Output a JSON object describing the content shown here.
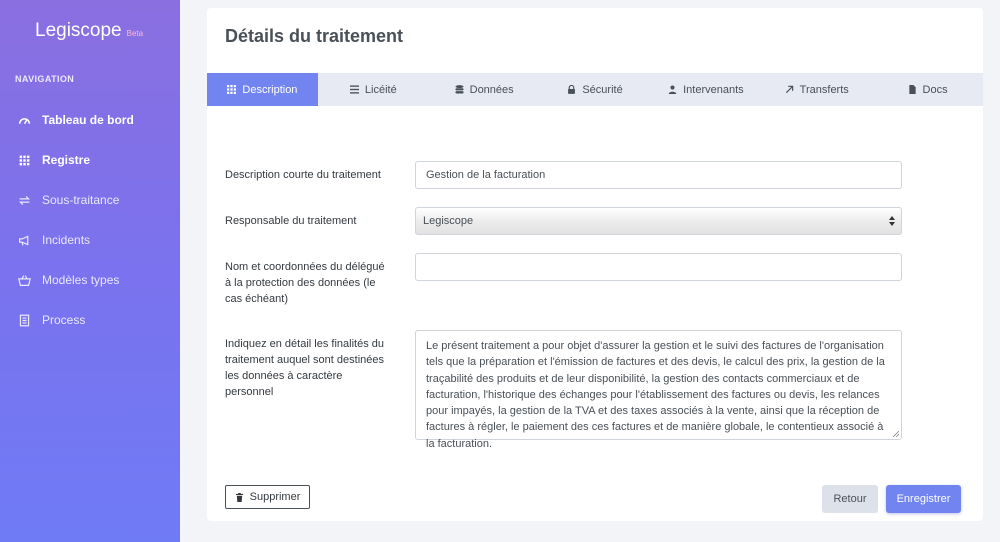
{
  "brand": {
    "name": "Legiscope",
    "badge": "Beta"
  },
  "sidebar": {
    "heading": "NAVIGATION",
    "items": [
      {
        "label": "Tableau de bord",
        "icon": "gauge-icon"
      },
      {
        "label": "Registre",
        "icon": "grid-icon"
      },
      {
        "label": "Sous-traitance",
        "icon": "exchange-icon"
      },
      {
        "label": "Incidents",
        "icon": "megaphone-icon"
      },
      {
        "label": "Modèles types",
        "icon": "basket-icon"
      },
      {
        "label": "Process",
        "icon": "document-icon"
      }
    ]
  },
  "page": {
    "title": "Détails du traitement"
  },
  "tabs": [
    {
      "label": "Description",
      "icon": "grid-icon"
    },
    {
      "label": "Licéité",
      "icon": "list-icon"
    },
    {
      "label": "Données",
      "icon": "database-icon"
    },
    {
      "label": "Sécurité",
      "icon": "lock-icon"
    },
    {
      "label": "Intervenants",
      "icon": "user-icon"
    },
    {
      "label": "Transferts",
      "icon": "arrow-icon"
    },
    {
      "label": "Docs",
      "icon": "file-icon"
    }
  ],
  "form": {
    "short_description": {
      "label": "Description courte du traitement",
      "value": "Gestion de la facturation"
    },
    "responsible": {
      "label": "Responsable du traitement",
      "value": "Legiscope"
    },
    "dpo": {
      "label": "Nom et coordonnées du délégué à la protection des données (le cas échéant)",
      "value": ""
    },
    "purposes": {
      "label": "Indiquez en détail les finalités du traitement auquel sont destinées les données à caractère personnel",
      "value": "Le présent traitement a pour objet d'assurer la gestion et le suivi des factures de l'organisation tels que la préparation et l'émission de factures et des devis, le calcul des prix, la gestion de la traçabilité des produits et de leur disponibilité, la gestion des contacts commerciaux et de facturation, l'historique des échanges pour l'établissement des factures ou devis, les relances pour impayés, la gestion de la TVA et des taxes associés à la vente, ainsi que la réception de factures à régler, le paiement des ces factures et de manière globale, le contentieux associé à la facturation."
    }
  },
  "actions": {
    "delete": "Supprimer",
    "back": "Retour",
    "save": "Enregistrer"
  },
  "colors": {
    "accent": "#7184f0",
    "sidebar_top": "#8a6fe0",
    "sidebar_bottom": "#6f7bf5",
    "tab_bar": "#e7eaf2"
  }
}
